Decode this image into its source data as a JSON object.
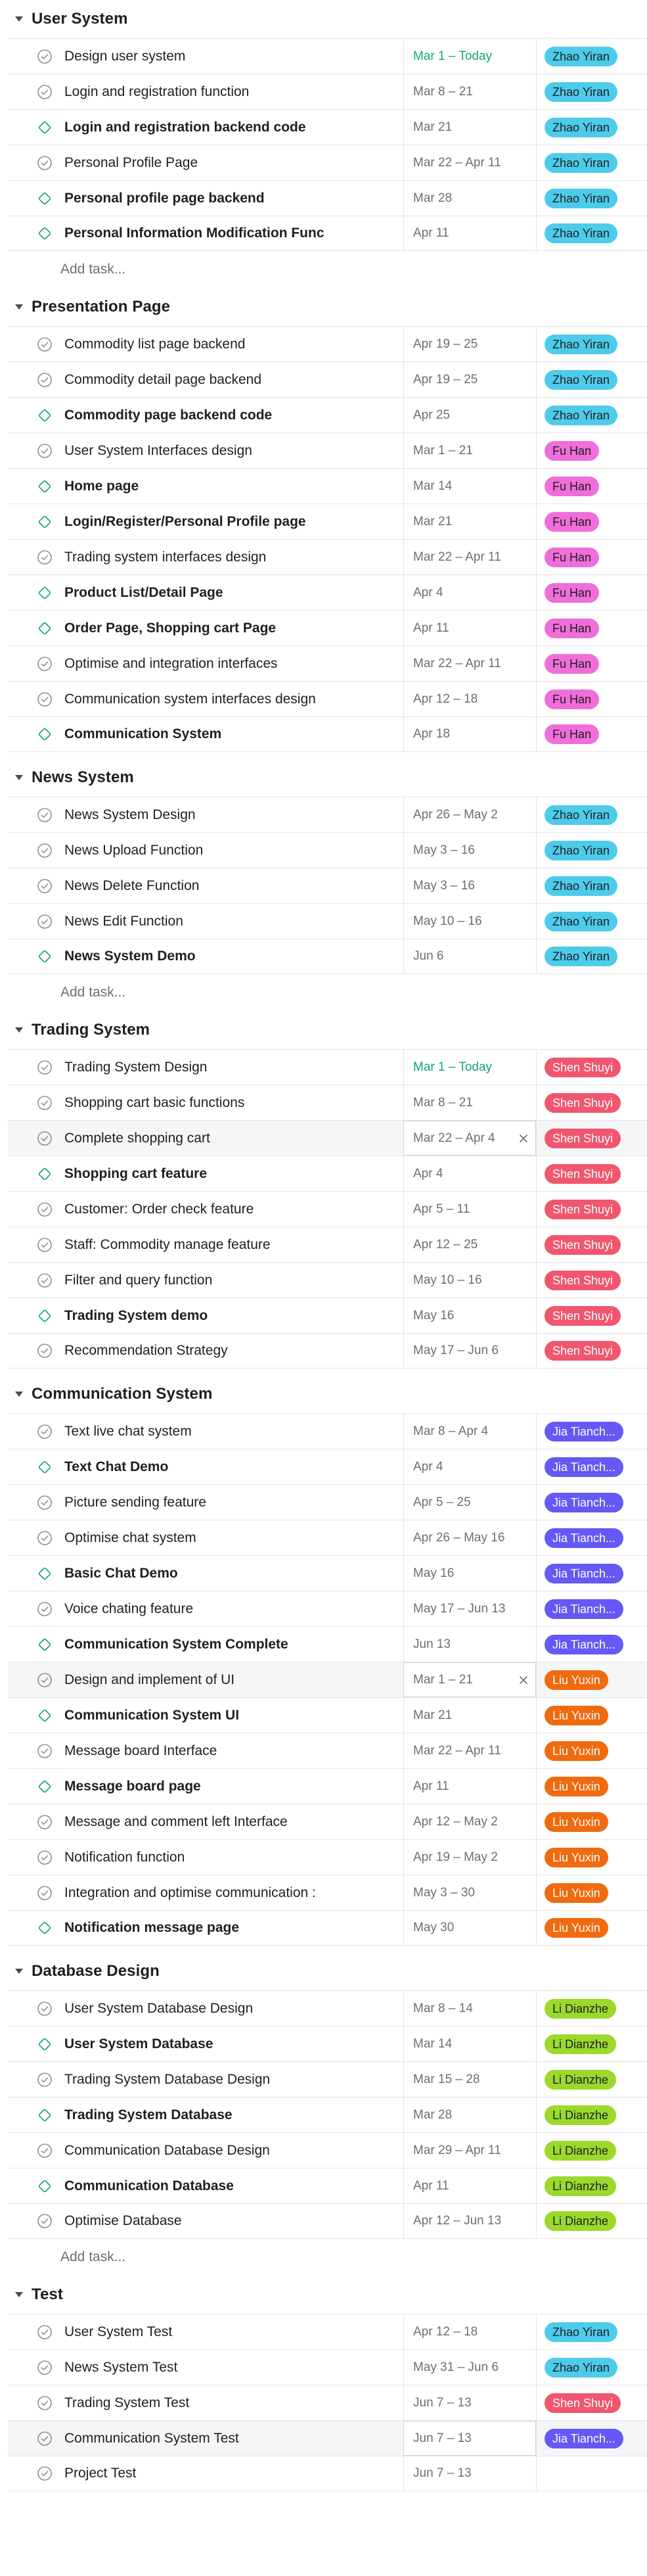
{
  "colors": {
    "Zhao Yiran": "#4dcbea",
    "Fu Han": "#f06ed9",
    "Shen Shuyi": "#f0566e",
    "Jia Tianch...": "#6558f5",
    "Liu Yuxin": "#f06a0f",
    "Li Dianzhe": "#9bd92b"
  },
  "sections": [
    {
      "title": "User System",
      "add_task": "Add task...",
      "tasks": [
        {
          "name": "Design user system",
          "milestone": false,
          "date": "Mar 1 – Today",
          "today": true,
          "assignee": "Zhao Yiran"
        },
        {
          "name": "Login and registration function",
          "milestone": false,
          "date": "Mar 8 – 21",
          "assignee": "Zhao Yiran"
        },
        {
          "name": "Login and registration backend code",
          "milestone": true,
          "date": "Mar 21",
          "assignee": "Zhao Yiran"
        },
        {
          "name": "Personal Profile Page",
          "milestone": false,
          "date": "Mar 22 – Apr 11",
          "assignee": "Zhao Yiran"
        },
        {
          "name": "Personal profile page backend",
          "milestone": true,
          "date": "Mar 28",
          "assignee": "Zhao Yiran"
        },
        {
          "name": "Personal Information Modification Func",
          "milestone": true,
          "date": "Apr 11",
          "assignee": "Zhao Yiran"
        }
      ]
    },
    {
      "title": "Presentation Page",
      "tasks": [
        {
          "name": "Commodity list page backend",
          "milestone": false,
          "date": "Apr 19 – 25",
          "assignee": "Zhao Yiran"
        },
        {
          "name": "Commodity detail page backend",
          "milestone": false,
          "date": "Apr 19 – 25",
          "assignee": "Zhao Yiran"
        },
        {
          "name": "Commodity page backend code",
          "milestone": true,
          "date": "Apr 25",
          "assignee": "Zhao Yiran"
        },
        {
          "name": "User System Interfaces design",
          "milestone": false,
          "date": "Mar 1 – 21",
          "assignee": "Fu Han"
        },
        {
          "name": "Home page",
          "milestone": true,
          "date": "Mar 14",
          "assignee": "Fu Han"
        },
        {
          "name": "Login/Register/Personal Profile page",
          "milestone": true,
          "date": "Mar 21",
          "assignee": "Fu Han"
        },
        {
          "name": "Trading system interfaces design",
          "milestone": false,
          "date": "Mar 22 – Apr 11",
          "assignee": "Fu Han"
        },
        {
          "name": "Product List/Detail Page",
          "milestone": true,
          "date": "Apr 4",
          "assignee": "Fu Han"
        },
        {
          "name": "Order Page, Shopping cart Page",
          "milestone": true,
          "date": "Apr 11",
          "assignee": "Fu Han"
        },
        {
          "name": "Optimise and integration interfaces",
          "milestone": false,
          "date": "Mar 22 – Apr 11",
          "assignee": "Fu Han"
        },
        {
          "name": "Communication system interfaces design",
          "milestone": false,
          "date": "Apr 12 – 18",
          "assignee": "Fu Han"
        },
        {
          "name": "Communication System",
          "milestone": true,
          "date": "Apr 18",
          "assignee": "Fu Han"
        }
      ]
    },
    {
      "title": "News System",
      "add_task": "Add task...",
      "tasks": [
        {
          "name": "News System Design",
          "milestone": false,
          "date": "Apr 26 – May 2",
          "assignee": "Zhao Yiran"
        },
        {
          "name": "News Upload Function",
          "milestone": false,
          "date": "May 3 – 16",
          "assignee": "Zhao Yiran"
        },
        {
          "name": "News Delete Function",
          "milestone": false,
          "date": "May 3 – 16",
          "assignee": "Zhao Yiran"
        },
        {
          "name": "News Edit Function",
          "milestone": false,
          "date": "May 10 – 16",
          "assignee": "Zhao Yiran"
        },
        {
          "name": "News System Demo",
          "milestone": true,
          "date": "Jun 6",
          "assignee": "Zhao Yiran"
        }
      ]
    },
    {
      "title": "Trading System",
      "tasks": [
        {
          "name": "Trading System Design",
          "milestone": false,
          "date": "Mar 1 – Today",
          "today": true,
          "assignee": "Shen Shuyi"
        },
        {
          "name": "Shopping cart basic functions",
          "milestone": false,
          "date": "Mar 8 – 21",
          "assignee": "Shen Shuyi"
        },
        {
          "name": "Complete shopping cart",
          "milestone": false,
          "date": "Mar 22 – Apr 4",
          "assignee": "Shen Shuyi",
          "highlight": true
        },
        {
          "name": "Shopping cart feature",
          "milestone": true,
          "date": "Apr 4",
          "assignee": "Shen Shuyi"
        },
        {
          "name": "Customer: Order check feature",
          "milestone": false,
          "date": "Apr 5 – 11",
          "assignee": "Shen Shuyi"
        },
        {
          "name": "Staff: Commodity manage feature",
          "milestone": false,
          "date": "Apr 12 – 25",
          "assignee": "Shen Shuyi"
        },
        {
          "name": "Filter and query function",
          "milestone": false,
          "date": "May 10 – 16",
          "assignee": "Shen Shuyi"
        },
        {
          "name": "Trading System demo",
          "milestone": true,
          "date": "May 16",
          "assignee": "Shen Shuyi"
        },
        {
          "name": "Recommendation Strategy",
          "milestone": false,
          "date": "May 17 – Jun 6",
          "assignee": "Shen Shuyi"
        }
      ]
    },
    {
      "title": "Communication System",
      "tasks": [
        {
          "name": "Text live chat system",
          "milestone": false,
          "date": "Mar 8 – Apr 4",
          "assignee": "Jia Tianch..."
        },
        {
          "name": "Text Chat Demo",
          "milestone": true,
          "date": "Apr 4",
          "assignee": "Jia Tianch..."
        },
        {
          "name": "Picture sending feature",
          "milestone": false,
          "date": "Apr 5 – 25",
          "assignee": "Jia Tianch..."
        },
        {
          "name": "Optimise chat system",
          "milestone": false,
          "date": "Apr 26 – May 16",
          "assignee": "Jia Tianch..."
        },
        {
          "name": "Basic Chat Demo",
          "milestone": true,
          "date": "May 16",
          "assignee": "Jia Tianch..."
        },
        {
          "name": "Voice chating feature",
          "milestone": false,
          "date": "May 17 – Jun 13",
          "assignee": "Jia Tianch..."
        },
        {
          "name": "Communication System Complete",
          "milestone": true,
          "date": "Jun 13",
          "assignee": "Jia Tianch..."
        },
        {
          "name": "Design and implement of UI",
          "milestone": false,
          "date": "Mar 1 – 21",
          "assignee": "Liu Yuxin",
          "highlight": true
        },
        {
          "name": "Communication System UI",
          "milestone": true,
          "date": "Mar 21",
          "assignee": "Liu Yuxin"
        },
        {
          "name": "Message board Interface",
          "milestone": false,
          "date": "Mar 22 – Apr 11",
          "assignee": "Liu Yuxin"
        },
        {
          "name": "Message board page",
          "milestone": true,
          "date": "Apr 11",
          "assignee": "Liu Yuxin"
        },
        {
          "name": "Message and comment left Interface",
          "milestone": false,
          "date": "Apr 12 – May 2",
          "assignee": "Liu Yuxin"
        },
        {
          "name": "Notification function",
          "milestone": false,
          "date": "Apr 19 – May 2",
          "assignee": "Liu Yuxin"
        },
        {
          "name": "Integration and optimise communication :",
          "milestone": false,
          "date": "May 3 – 30",
          "assignee": "Liu Yuxin"
        },
        {
          "name": "Notification message page",
          "milestone": true,
          "date": "May 30",
          "assignee": "Liu Yuxin"
        }
      ]
    },
    {
      "title": "Database Design",
      "add_task": "Add task...",
      "tasks": [
        {
          "name": "User System Database Design",
          "milestone": false,
          "date": "Mar 8 – 14",
          "assignee": "Li Dianzhe"
        },
        {
          "name": "User System Database",
          "milestone": true,
          "date": "Mar 14",
          "assignee": "Li Dianzhe"
        },
        {
          "name": "Trading System Database Design",
          "milestone": false,
          "date": "Mar 15 – 28",
          "assignee": "Li Dianzhe"
        },
        {
          "name": "Trading System Database",
          "milestone": true,
          "date": "Mar 28",
          "assignee": "Li Dianzhe"
        },
        {
          "name": "Communication Database Design",
          "milestone": false,
          "date": "Mar 29 – Apr 11",
          "assignee": "Li Dianzhe"
        },
        {
          "name": "Communication Database",
          "milestone": true,
          "date": "Apr 11",
          "assignee": "Li Dianzhe"
        },
        {
          "name": "Optimise Database",
          "milestone": false,
          "date": "Apr 12 – Jun 13",
          "assignee": "Li Dianzhe"
        }
      ]
    },
    {
      "title": "Test",
      "tasks": [
        {
          "name": "User System Test",
          "milestone": false,
          "date": "Apr 12 – 18",
          "assignee": "Zhao Yiran"
        },
        {
          "name": "News System Test",
          "milestone": false,
          "date": "May 31 – Jun 6",
          "assignee": "Zhao Yiran"
        },
        {
          "name": "Trading System Test",
          "milestone": false,
          "date": "Jun 7 – 13",
          "assignee": "Shen Shuyi"
        },
        {
          "name": "Communication System Test",
          "milestone": false,
          "date": "Jun 7 – 13",
          "assignee": "Jia Tianch...",
          "highlight": true
        },
        {
          "name": "Project Test",
          "milestone": false,
          "date": "Jun 7 – 13",
          "assignee": ""
        }
      ]
    }
  ]
}
